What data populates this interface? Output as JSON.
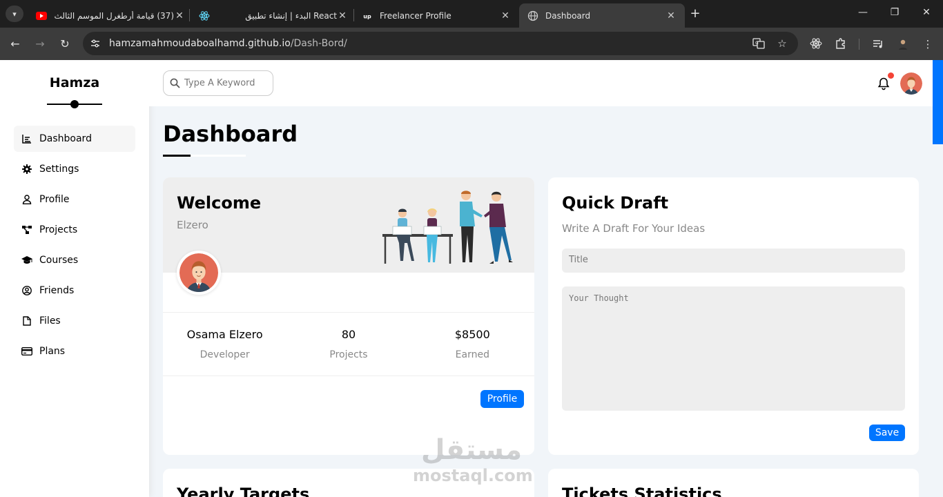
{
  "browser": {
    "tabs": [
      {
        "title": "(37) قيامة أرطغرل الموسم الثالث",
        "favicon": "youtube-icon"
      },
      {
        "title": "React البدء | إنشاء تطبيق",
        "favicon": "react-icon"
      },
      {
        "title": "Freelancer Profile",
        "favicon": "upwork-icon"
      },
      {
        "title": "Dashboard",
        "favicon": "globe-icon"
      }
    ],
    "url_host": "hamzamahmoudaboalhamd.github.io",
    "url_path": "/Dash-Bord/"
  },
  "sidebar": {
    "brand": "Hamza",
    "items": [
      {
        "label": "Dashboard",
        "icon": "chart-icon"
      },
      {
        "label": "Settings",
        "icon": "gear-icon"
      },
      {
        "label": "Profile",
        "icon": "user-icon"
      },
      {
        "label": "Projects",
        "icon": "diagram-icon"
      },
      {
        "label": "Courses",
        "icon": "graduation-cap-icon"
      },
      {
        "label": "Friends",
        "icon": "user-circle-icon"
      },
      {
        "label": "Files",
        "icon": "file-icon"
      },
      {
        "label": "Plans",
        "icon": "credit-card-icon"
      }
    ]
  },
  "header": {
    "search_placeholder": "Type A Keyword"
  },
  "page_title": "Dashboard",
  "welcome": {
    "title": "Welcome",
    "subtitle": "Elzero",
    "stats": [
      {
        "value": "Osama Elzero",
        "label": "Developer"
      },
      {
        "value": "80",
        "label": "Projects"
      },
      {
        "value": "$8500",
        "label": "Earned"
      }
    ],
    "button": "Profile"
  },
  "draft": {
    "title": "Quick Draft",
    "subtitle": "Write A Draft For Your Ideas",
    "title_placeholder": "Title",
    "body_placeholder": "Your Thought",
    "button": "Save"
  },
  "bottom_cards": {
    "left_title": "Yearly Targets",
    "right_title": "Tickets Statistics"
  },
  "watermark": {
    "arabic": "مستقل",
    "latin": "mostaql.com"
  },
  "colors": {
    "accent": "#0075ff",
    "notification": "#f44336"
  }
}
